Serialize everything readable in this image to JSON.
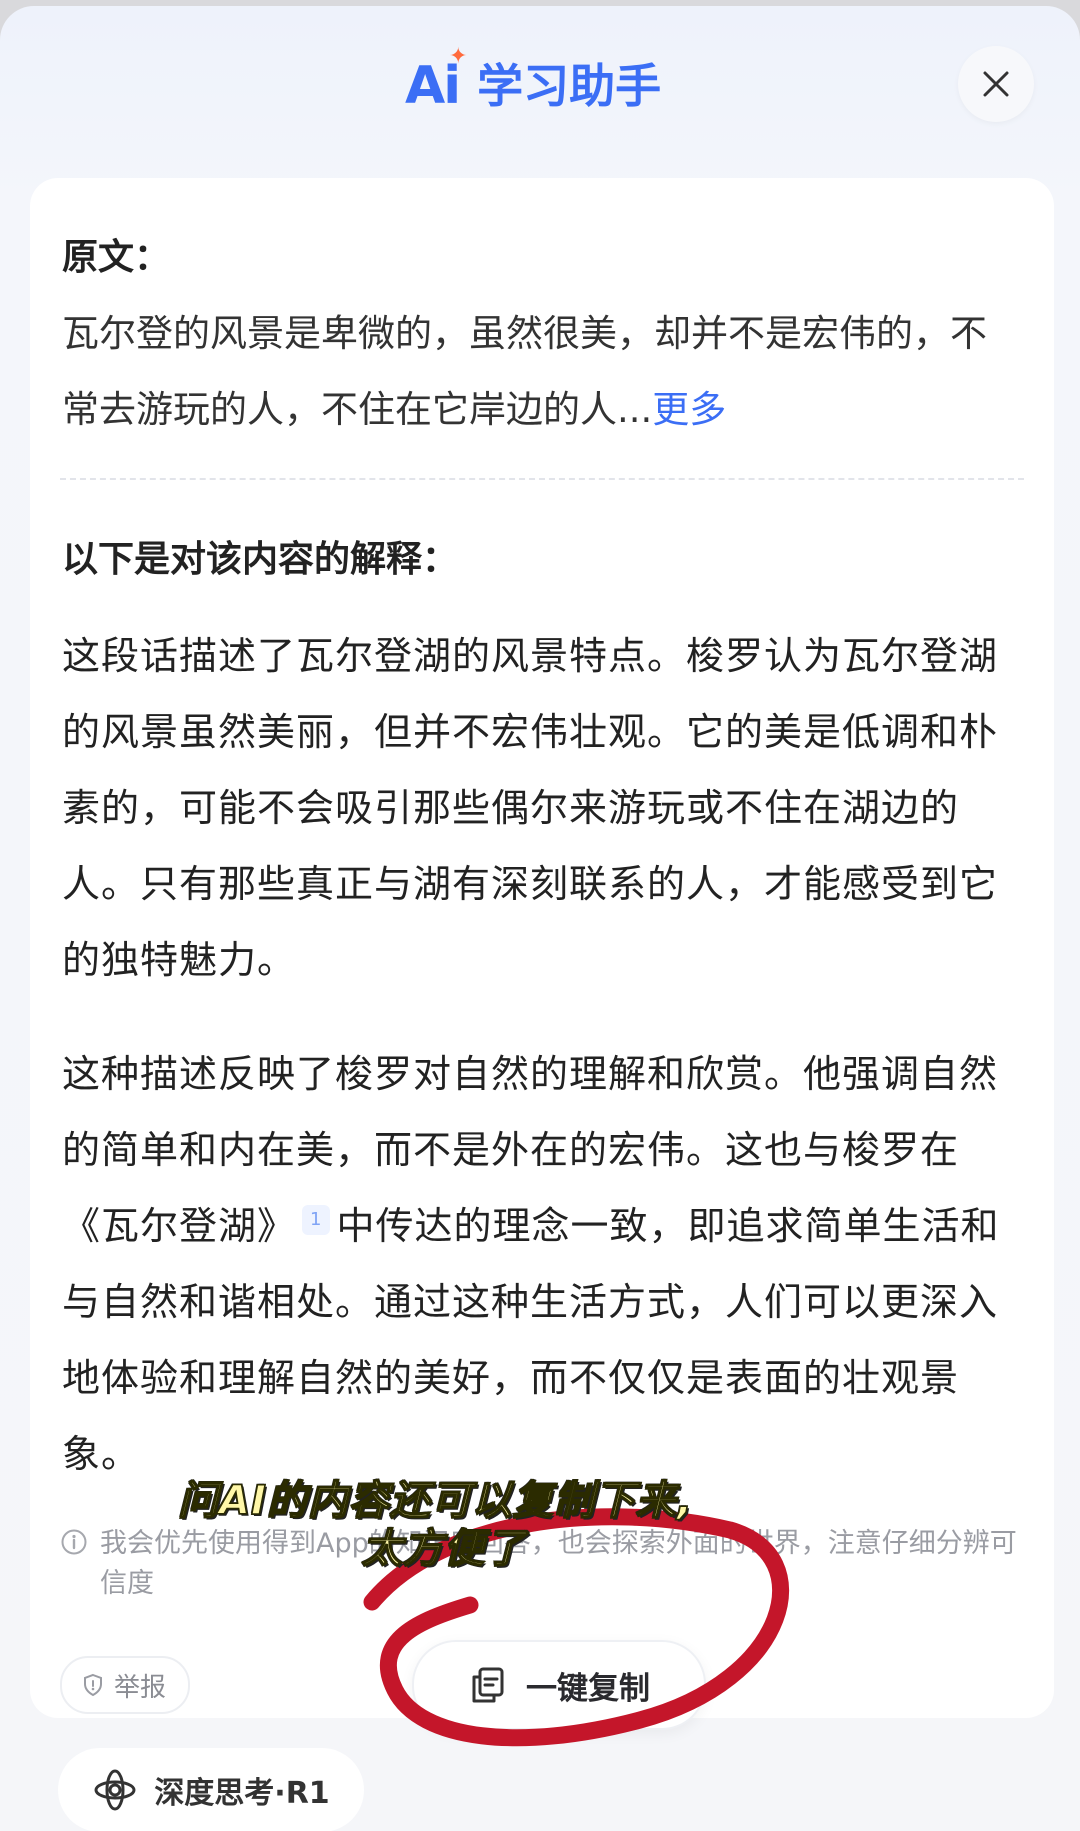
{
  "header": {
    "logo_text": "Ai",
    "title": "学习助手"
  },
  "original": {
    "label": "原文：",
    "text": "瓦尔登的风景是卑微的，虽然很美，却并不是宏伟的，不常去游玩的人，不住在它岸边的人...",
    "more_link": "更多"
  },
  "explanation": {
    "label": "以下是对该内容的解释：",
    "para1": "这段话描述了瓦尔登湖的风景特点。梭罗认为瓦尔登湖的风景虽然美丽，但并不宏伟壮观。它的美是低调和朴素的，可能不会吸引那些偶尔来游玩或不住在湖边的人。只有那些真正与湖有深刻联系的人，才能感受到它的独特魅力。",
    "para2_a": "这种描述反映了梭罗对自然的理解和欣赏。他强调自然的简单和内在美，而不是外在的宏伟。这也与梭罗在《瓦尔登湖》",
    "citation": "1",
    "para2_b": "中传达的理念一致，即追求简单生活和与自然和谐相处。通过这种生活方式，人们可以更深入地体验和理解自然的美好，而不仅仅是表面的壮观景象。"
  },
  "disclaimer": "我会优先使用得到App的知识库回答，也会探索外面的世界，注意仔细分辨可信度",
  "actions": {
    "report_label": "举报",
    "copy_label": "一键复制",
    "deep_think_label": "深度思考·R1"
  },
  "overlay_caption": {
    "line1": "问AI的内容还可以复制下来,",
    "line2": "太方便了"
  },
  "colors": {
    "accent": "#3b6ef5",
    "annotation": "#c4162a"
  },
  "icons": {
    "close": "close-icon",
    "info": "info-icon",
    "shield": "shield-icon",
    "copy": "copy-icon",
    "deep_think": "atom-icon"
  }
}
